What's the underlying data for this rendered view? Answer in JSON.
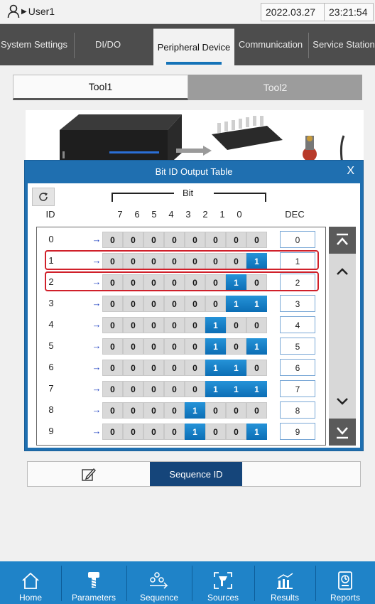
{
  "status": {
    "user": "User1",
    "date": "2022.03.27",
    "time": "23:21:54"
  },
  "topnav": {
    "items": [
      {
        "label": "System Settings",
        "active": false
      },
      {
        "label": "DI/DO",
        "active": false
      },
      {
        "label": "Peripheral Device",
        "active": true
      },
      {
        "label": "Communication",
        "active": false
      },
      {
        "label": "Service Station",
        "active": false
      }
    ]
  },
  "tooltabs": [
    {
      "label": "Tool1",
      "active": true
    },
    {
      "label": "Tool2",
      "active": false
    }
  ],
  "modal": {
    "title": "Bit ID Output Table",
    "close": "X",
    "bit_label": "Bit",
    "id_header": "ID",
    "dec_header": "DEC",
    "bit_headers": [
      "7",
      "6",
      "5",
      "4",
      "3",
      "2",
      "1",
      "0"
    ],
    "arrow": "→",
    "rows": [
      {
        "id": "0",
        "bits": [
          "0",
          "0",
          "0",
          "0",
          "0",
          "0",
          "0",
          "0"
        ],
        "dec": "0",
        "highlight": false
      },
      {
        "id": "1",
        "bits": [
          "0",
          "0",
          "0",
          "0",
          "0",
          "0",
          "0",
          "1"
        ],
        "dec": "1",
        "highlight": true
      },
      {
        "id": "2",
        "bits": [
          "0",
          "0",
          "0",
          "0",
          "0",
          "0",
          "1",
          "0"
        ],
        "dec": "2",
        "highlight": true
      },
      {
        "id": "3",
        "bits": [
          "0",
          "0",
          "0",
          "0",
          "0",
          "0",
          "1",
          "1"
        ],
        "dec": "3",
        "highlight": false
      },
      {
        "id": "4",
        "bits": [
          "0",
          "0",
          "0",
          "0",
          "0",
          "1",
          "0",
          "0"
        ],
        "dec": "4",
        "highlight": false
      },
      {
        "id": "5",
        "bits": [
          "0",
          "0",
          "0",
          "0",
          "0",
          "1",
          "0",
          "1"
        ],
        "dec": "5",
        "highlight": false
      },
      {
        "id": "6",
        "bits": [
          "0",
          "0",
          "0",
          "0",
          "0",
          "1",
          "1",
          "0"
        ],
        "dec": "6",
        "highlight": false
      },
      {
        "id": "7",
        "bits": [
          "0",
          "0",
          "0",
          "0",
          "0",
          "1",
          "1",
          "1"
        ],
        "dec": "7",
        "highlight": false
      },
      {
        "id": "8",
        "bits": [
          "0",
          "0",
          "0",
          "0",
          "1",
          "0",
          "0",
          "0"
        ],
        "dec": "8",
        "highlight": false
      },
      {
        "id": "9",
        "bits": [
          "0",
          "0",
          "0",
          "0",
          "1",
          "0",
          "0",
          "1"
        ],
        "dec": "9",
        "highlight": false
      }
    ]
  },
  "sequence": {
    "label": "Sequence ID",
    "icon": "edit-icon"
  },
  "botnav": {
    "items": [
      {
        "label": "Home",
        "icon": "home-icon"
      },
      {
        "label": "Parameters",
        "icon": "screw-icon"
      },
      {
        "label": "Sequence",
        "icon": "sequence-icon"
      },
      {
        "label": "Sources",
        "icon": "sources-icon"
      },
      {
        "label": "Results",
        "icon": "results-icon"
      },
      {
        "label": "Reports",
        "icon": "reports-icon"
      }
    ]
  },
  "colors": {
    "accent": "#1f6fb0",
    "bit_on": "#1a80c8",
    "highlight": "#d0202a",
    "nav": "#1f83c8"
  }
}
